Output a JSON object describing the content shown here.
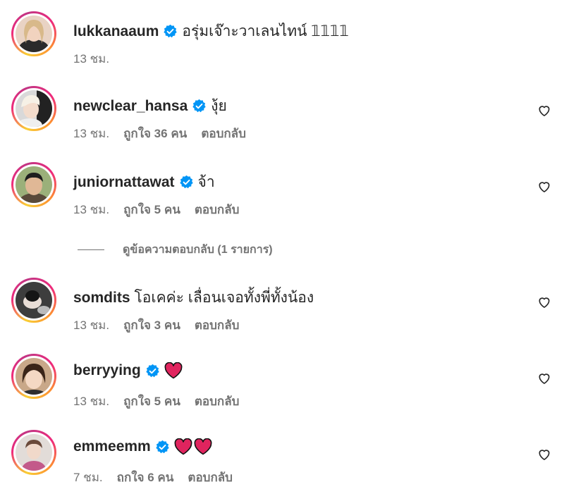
{
  "comments": [
    {
      "username": "lukkanaaum",
      "verified": true,
      "text": "อรุ่มเจ๊าะวาเลนไทน์ 𝟙𝟙𝟙𝟙",
      "time": "13 ชม.",
      "likes": "",
      "reply": "",
      "has_like_button": false
    },
    {
      "username": "newclear_hansa",
      "verified": true,
      "text": "งุ้ย",
      "time": "13 ชม.",
      "likes": "ถูกใจ 36 คน",
      "reply": "ตอบกลับ",
      "has_like_button": true
    },
    {
      "username": "juniornattawat",
      "verified": true,
      "text": "จ้า",
      "time": "13 ชม.",
      "likes": "ถูกใจ 5 คน",
      "reply": "ตอบกลับ",
      "has_like_button": true
    },
    {
      "username": "somdits",
      "verified": false,
      "text": "โอเคค่ะ เลื่อนเจอทั้งพี่ทั้งน้อง",
      "time": "13 ชม.",
      "likes": "ถูกใจ 3 คน",
      "reply": "ตอบกลับ",
      "has_like_button": true
    },
    {
      "username": "berryying",
      "verified": true,
      "text": "",
      "emoji": [
        "red-heart"
      ],
      "time": "13 ชม.",
      "likes": "ถูกใจ 5 คน",
      "reply": "ตอบกลับ",
      "has_like_button": true
    },
    {
      "username": "emmeemm",
      "verified": true,
      "text": "",
      "emoji": [
        "red-heart",
        "red-heart"
      ],
      "time": "7 ชม.",
      "likes": "ถูกใจ 6 คน",
      "reply": "ตอบกลับ",
      "has_like_button": true
    }
  ],
  "view_replies": "ดูข้อความตอบกลับ (1 รายการ)",
  "colors": {
    "verified_badge": "#0095f6",
    "heart_emoji": "#e0245e",
    "muted_text": "#737373"
  }
}
